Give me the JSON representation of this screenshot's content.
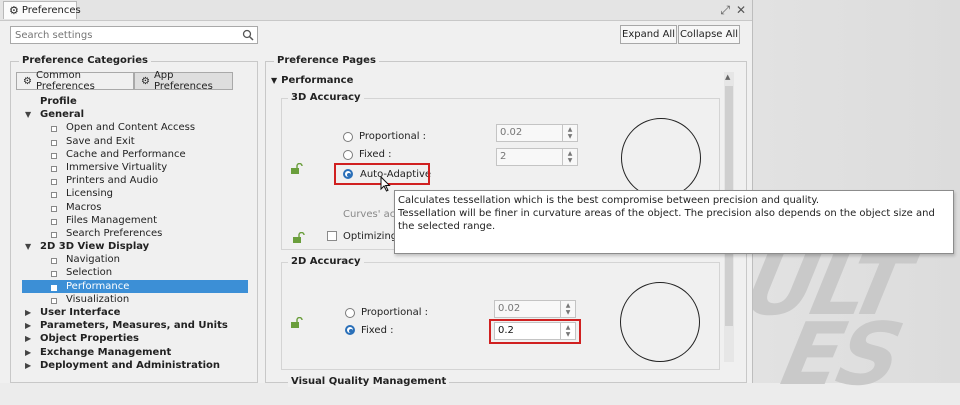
{
  "window": {
    "title": "Preferences"
  },
  "search": {
    "placeholder": "Search settings"
  },
  "buttons": {
    "expand_all": "Expand All",
    "collapse_all": "Collapse All"
  },
  "categories": {
    "title": "Preference Categories",
    "tabs": [
      "Common Preferences",
      "App Preferences"
    ],
    "tree": [
      {
        "label": "Profile",
        "level": 0,
        "bold": true,
        "arrow": ""
      },
      {
        "label": "General",
        "level": 0,
        "bold": true,
        "arrow": "down"
      },
      {
        "label": "Open and Content Access",
        "level": 1
      },
      {
        "label": "Save and Exit",
        "level": 1
      },
      {
        "label": "Cache and Performance",
        "level": 1
      },
      {
        "label": "Immersive Virtuality",
        "level": 1
      },
      {
        "label": "Printers and Audio",
        "level": 1
      },
      {
        "label": "Licensing",
        "level": 1
      },
      {
        "label": "Macros",
        "level": 1
      },
      {
        "label": "Files Management",
        "level": 1
      },
      {
        "label": "Search Preferences",
        "level": 1
      },
      {
        "label": "2D 3D View Display",
        "level": 0,
        "bold": true,
        "arrow": "down"
      },
      {
        "label": "Navigation",
        "level": 1
      },
      {
        "label": "Selection",
        "level": 1
      },
      {
        "label": "Performance",
        "level": 1,
        "selected": true
      },
      {
        "label": "Visualization",
        "level": 1
      },
      {
        "label": "User Interface",
        "level": 0,
        "bold": true,
        "arrow": "right"
      },
      {
        "label": "Parameters, Measures, and Units",
        "level": 0,
        "bold": true,
        "arrow": "right"
      },
      {
        "label": "Object Properties",
        "level": 0,
        "bold": true,
        "arrow": "right"
      },
      {
        "label": "Exchange Management",
        "level": 0,
        "bold": true,
        "arrow": "right"
      },
      {
        "label": "Deployment and Administration",
        "level": 0,
        "bold": true,
        "arrow": "right"
      }
    ]
  },
  "pages": {
    "title": "Preference Pages",
    "section": "Performance",
    "accuracy3d": {
      "title": "3D Accuracy",
      "proportional_label": "Proportional :",
      "proportional_value": "0.02",
      "fixed_label": "Fixed :",
      "fixed_value": "2",
      "auto_adaptive_label": "Auto-Adaptive",
      "curves_label": "Curves' acc",
      "optimizing_label": "Optimizing"
    },
    "accuracy2d": {
      "title": "2D Accuracy",
      "proportional_label": "Proportional :",
      "proportional_value": "0.02",
      "fixed_label": "Fixed :",
      "fixed_value": "0.2"
    },
    "next_section": "Visual Quality Management"
  },
  "tooltip": {
    "line1": "Calculates tessellation which is the best compromise between precision and quality.",
    "line2": "Tessellation will be finer in curvature areas of the object. The precision also depends on the object size and the selected range."
  },
  "watermark": "ULT\nES",
  "colors": {
    "selection": "#3c8fd6",
    "highlight_box": "#d02020",
    "radio_on": "#2a6fb8"
  }
}
